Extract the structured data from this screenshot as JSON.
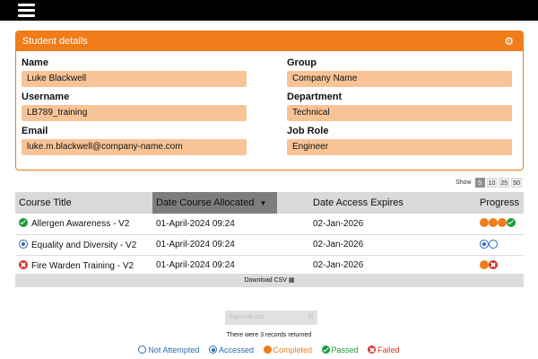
{
  "header": {
    "menu_icon": "hamburger-menu-icon"
  },
  "student_panel": {
    "title": "Student details",
    "settings_icon": "gear-icon",
    "fields": {
      "name_label": "Name",
      "name_value": "Luke Blackwell",
      "username_label": "Username",
      "username_value": "LB789_training",
      "email_label": "Email",
      "email_value": "luke.m.blackwell@company-name.com",
      "group_label": "Group",
      "group_value": "Company Name",
      "department_label": "Department",
      "department_value": "Technical",
      "jobrole_label": "Job Role",
      "jobrole_value": "Engineer"
    }
  },
  "pagination": {
    "show_label": "Show",
    "options": [
      "5",
      "10",
      "25",
      "50"
    ],
    "selected": "5"
  },
  "table": {
    "headers": {
      "course_title": "Course Title",
      "date_allocated": "Date Course Allocated",
      "date_expires": "Date Access Expires",
      "progress": "Progress"
    },
    "rows": [
      {
        "status": "passed",
        "title": "Allergen Awareness - V2",
        "allocated": "01-April-2024 09:24",
        "expires": "02-Jan-2026",
        "progress": [
          "completed",
          "completed",
          "completed",
          "passed"
        ]
      },
      {
        "status": "accessed",
        "title": "Equality and Diversity - V2",
        "allocated": "01-April-2024 09:24",
        "expires": "02-Jan-2026",
        "progress": [
          "accessed",
          "not_attempted"
        ]
      },
      {
        "status": "failed",
        "title": "Fire Warden Training - V2",
        "allocated": "01-April-2024 09:24",
        "expires": "02-Jan-2026",
        "progress": [
          "completed",
          "failed"
        ]
      }
    ]
  },
  "download_csv_label": "Download CSV",
  "export_all_label": "Export All CSV",
  "records_text": "There were 3 records returned",
  "legend": {
    "not_attempted": "Not Attempted",
    "accessed": "Accessed",
    "completed": "Completed",
    "passed": "Passed",
    "failed": "Failed"
  },
  "colors": {
    "accent_orange": "#f07c1a",
    "field_fill": "#f8c497",
    "passed": "#1e9a3c",
    "failed": "#d9312b",
    "accessed": "#2b6cb0"
  }
}
